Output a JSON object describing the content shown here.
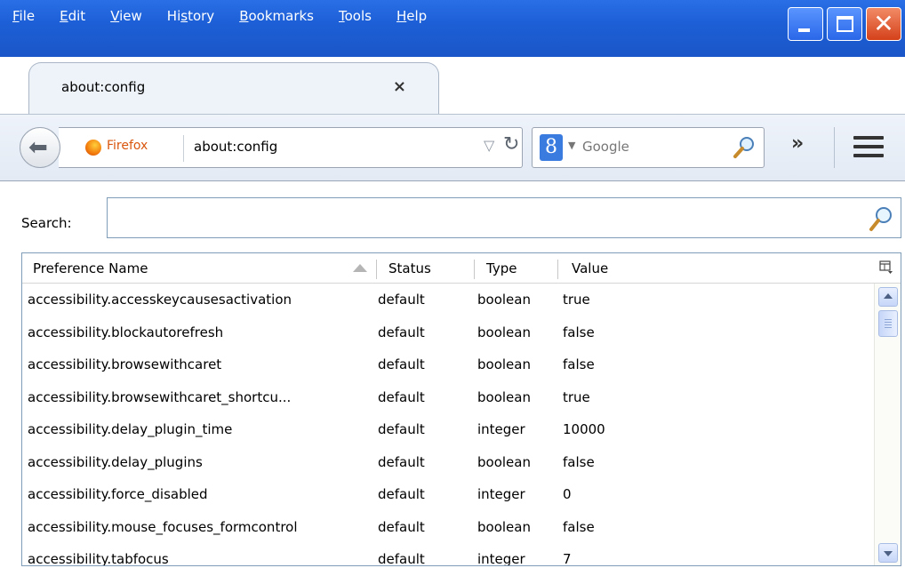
{
  "menu": {
    "items": [
      {
        "label": "File",
        "accel_index": 0
      },
      {
        "label": "Edit",
        "accel_index": 0
      },
      {
        "label": "View",
        "accel_index": 0
      },
      {
        "label": "History",
        "accel_index": 2
      },
      {
        "label": "Bookmarks",
        "accel_index": 0
      },
      {
        "label": "Tools",
        "accel_index": 0
      },
      {
        "label": "Help",
        "accel_index": 0
      }
    ]
  },
  "tab": {
    "title": "about:config",
    "close": "×"
  },
  "newtab": {
    "label": "+"
  },
  "navbar": {
    "back_icon": "back-arrow-icon",
    "identity_label": "Firefox",
    "url": "about:config",
    "search_engine_letter": "8",
    "search_placeholder": "Google",
    "overflow": "»"
  },
  "config": {
    "search_label": "Search:",
    "search_value": "",
    "columns": {
      "name": "Preference Name",
      "status": "Status",
      "type": "Type",
      "value": "Value"
    },
    "rows": [
      {
        "name": "accessibility.accesskeycausesactivation",
        "status": "default",
        "type": "boolean",
        "value": "true"
      },
      {
        "name": "accessibility.blockautorefresh",
        "status": "default",
        "type": "boolean",
        "value": "false"
      },
      {
        "name": "accessibility.browsewithcaret",
        "status": "default",
        "type": "boolean",
        "value": "false"
      },
      {
        "name": "accessibility.browsewithcaret_shortcu...",
        "status": "default",
        "type": "boolean",
        "value": "true"
      },
      {
        "name": "accessibility.delay_plugin_time",
        "status": "default",
        "type": "integer",
        "value": "10000"
      },
      {
        "name": "accessibility.delay_plugins",
        "status": "default",
        "type": "boolean",
        "value": "false"
      },
      {
        "name": "accessibility.force_disabled",
        "status": "default",
        "type": "integer",
        "value": "0"
      },
      {
        "name": "accessibility.mouse_focuses_formcontrol",
        "status": "default",
        "type": "boolean",
        "value": "false"
      },
      {
        "name": "accessibility.tabfocus",
        "status": "default",
        "type": "integer",
        "value": "7"
      }
    ]
  },
  "colors": {
    "titlebar": "#1d5fd6",
    "firefox_label": "#d9560e",
    "close_button": "#d4411a"
  }
}
